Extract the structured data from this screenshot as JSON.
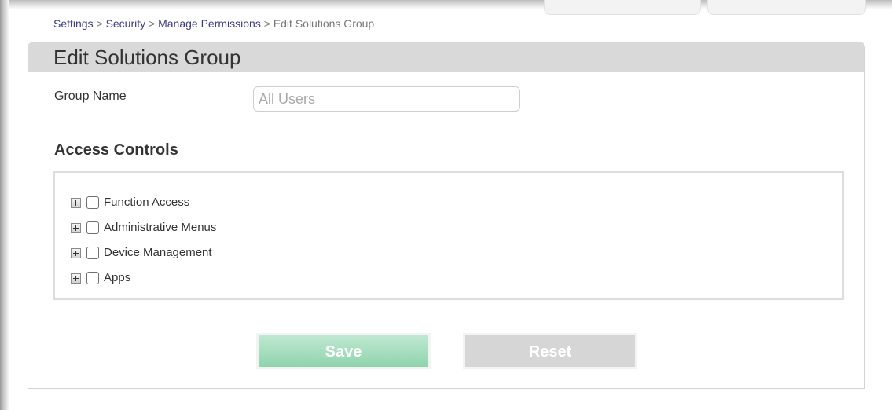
{
  "breadcrumb": {
    "items": [
      "Settings",
      "Security",
      "Manage Permissions"
    ],
    "separator": ">",
    "current": "Edit Solutions Group"
  },
  "panel": {
    "title": "Edit Solutions Group"
  },
  "form": {
    "group_name_label": "Group Name",
    "group_name_placeholder": "All Users",
    "group_name_value": ""
  },
  "access_controls": {
    "heading": "Access Controls",
    "items": [
      {
        "label": "Function Access",
        "checked": false,
        "expanded": false
      },
      {
        "label": "Administrative Menus",
        "checked": false,
        "expanded": false
      },
      {
        "label": "Device Management",
        "checked": false,
        "expanded": false
      },
      {
        "label": "Apps",
        "checked": false,
        "expanded": false
      }
    ]
  },
  "buttons": {
    "save_label": "Save",
    "reset_label": "Reset"
  },
  "icons": {
    "expander": "plus-box-icon",
    "checkbox": "checkbox-icon"
  },
  "colors": {
    "header_bg": "#d9d9d9",
    "link": "#3b3b8a",
    "save_button": "#8fd4ad",
    "reset_button": "#d6d6d6"
  }
}
